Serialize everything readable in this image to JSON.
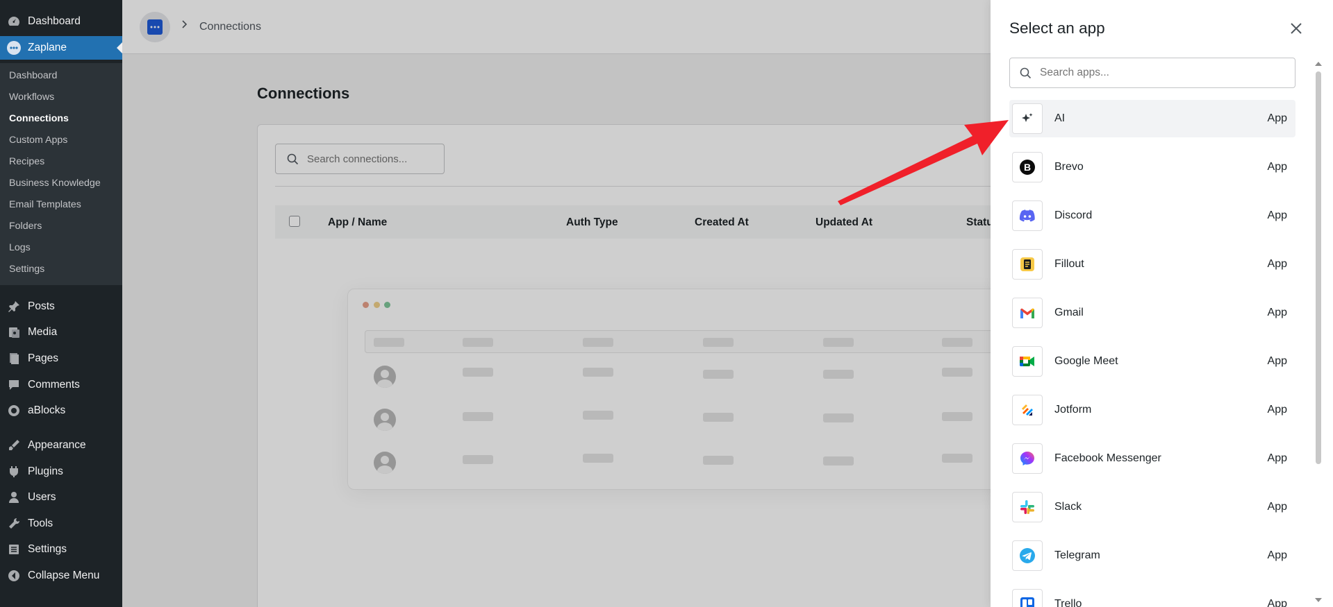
{
  "sidebar": {
    "top_items": [
      {
        "label": "Dashboard",
        "icon": "dashboard-icon"
      },
      {
        "label": "Zaplane",
        "icon": "zaplane-icon"
      }
    ],
    "submenu": [
      "Dashboard",
      "Workflows",
      "Connections",
      "Custom Apps",
      "Recipes",
      "Business Knowledge",
      "Email Templates",
      "Folders",
      "Logs",
      "Settings"
    ],
    "bottom_items": [
      {
        "label": "Posts",
        "icon": "pin-icon"
      },
      {
        "label": "Media",
        "icon": "media-icon"
      },
      {
        "label": "Pages",
        "icon": "pages-icon"
      },
      {
        "label": "Comments",
        "icon": "comment-icon"
      },
      {
        "label": "aBlocks",
        "icon": "blocks-icon"
      },
      {
        "label": "Appearance",
        "icon": "brush-icon"
      },
      {
        "label": "Plugins",
        "icon": "plug-icon"
      },
      {
        "label": "Users",
        "icon": "user-icon"
      },
      {
        "label": "Tools",
        "icon": "wrench-icon"
      },
      {
        "label": "Settings",
        "icon": "settings-icon"
      },
      {
        "label": "Collapse Menu",
        "icon": "collapse-icon"
      }
    ]
  },
  "breadcrumb": {
    "current": "Connections"
  },
  "main": {
    "title": "Connections",
    "search_placeholder": "Search connections...",
    "columns": [
      "App / Name",
      "Auth Type",
      "Created At",
      "Updated At",
      "Statu"
    ]
  },
  "drawer": {
    "title": "Select an app",
    "search_placeholder": "Search apps...",
    "apps": [
      {
        "name": "AI",
        "type": "App",
        "icon": "sparkle-icon"
      },
      {
        "name": "Brevo",
        "type": "App",
        "icon": "brevo-icon"
      },
      {
        "name": "Discord",
        "type": "App",
        "icon": "discord-icon"
      },
      {
        "name": "Fillout",
        "type": "App",
        "icon": "fillout-icon"
      },
      {
        "name": "Gmail",
        "type": "App",
        "icon": "gmail-icon"
      },
      {
        "name": "Google Meet",
        "type": "App",
        "icon": "google-meet-icon"
      },
      {
        "name": "Jotform",
        "type": "App",
        "icon": "jotform-icon"
      },
      {
        "name": "Facebook Messenger",
        "type": "App",
        "icon": "messenger-icon"
      },
      {
        "name": "Slack",
        "type": "App",
        "icon": "slack-icon"
      },
      {
        "name": "Telegram",
        "type": "App",
        "icon": "telegram-icon"
      },
      {
        "name": "Trello",
        "type": "App",
        "icon": "trello-icon"
      }
    ]
  },
  "colors": {
    "admin_bg": "#1d2327",
    "accent": "#2271b1",
    "annotation_arrow": "#f0202a"
  }
}
